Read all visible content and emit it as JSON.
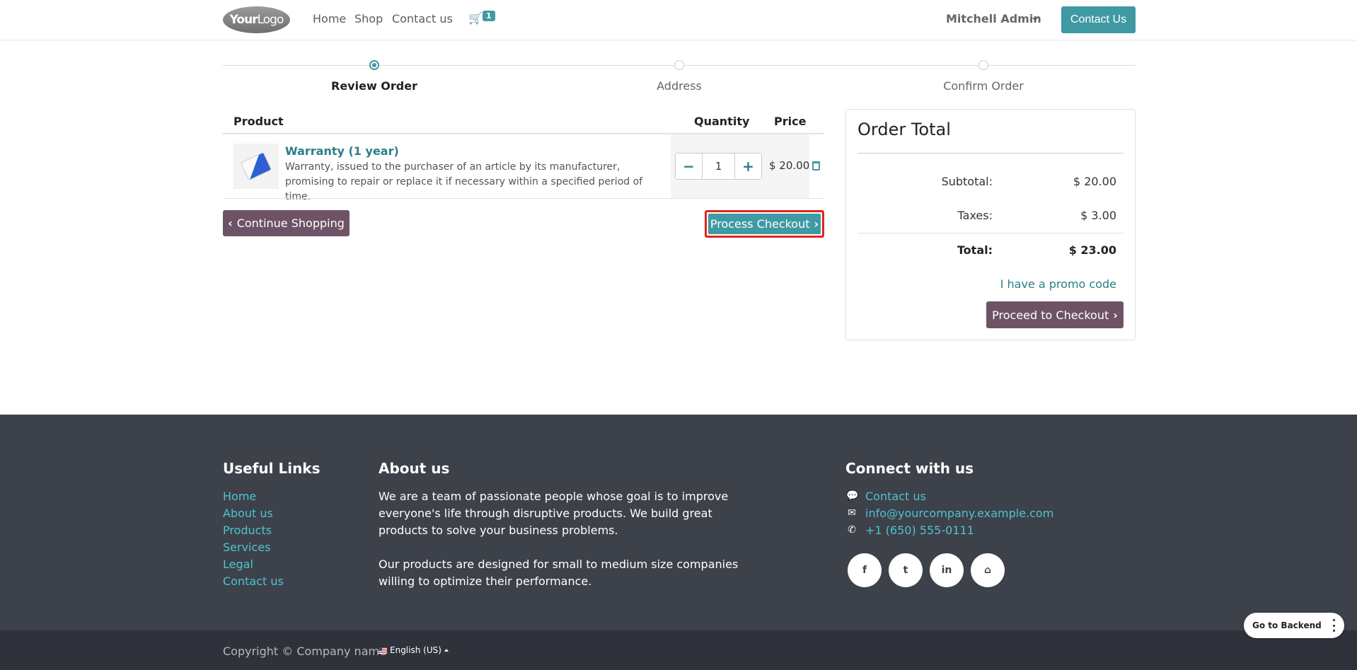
{
  "header": {
    "logo": {
      "prefix": "Your",
      "suffix": "Logo"
    },
    "nav": [
      "Home",
      "Shop",
      "Contact us"
    ],
    "cart_count": "1",
    "user_name": "Mitchell Admin",
    "contact_button": "Contact Us"
  },
  "steps": [
    {
      "label": "Review Order",
      "active": true
    },
    {
      "label": "Address",
      "active": false
    },
    {
      "label": "Confirm Order",
      "active": false
    }
  ],
  "cart": {
    "columns": {
      "product": "Product",
      "quantity": "Quantity",
      "price": "Price"
    },
    "items": [
      {
        "name": "Warranty (1 year)",
        "description": "Warranty, issued to the purchaser of an article by its manufacturer, promising to repair or replace it if necessary within a specified period of time.",
        "quantity": "1",
        "price": "$ 20.00"
      }
    ],
    "continue_label": "Continue Shopping",
    "process_checkout_label": "Process Checkout"
  },
  "order_total": {
    "title": "Order Total",
    "subtotal_label": "Subtotal:",
    "subtotal_value": "$ 20.00",
    "taxes_label": "Taxes:",
    "taxes_value": "$ 3.00",
    "total_label": "Total:",
    "total_value": "$ 23.00",
    "promo_link": "I have a promo code",
    "proceed_label": "Proceed to Checkout"
  },
  "footer": {
    "useful_links_title": "Useful Links",
    "useful_links": [
      "Home",
      "About us",
      "Products",
      "Services",
      "Legal",
      "Contact us"
    ],
    "about_title": "About us",
    "about_p1": "We are a team of passionate people whose goal is to improve everyone's life through disruptive products. We build great products to solve your business problems.",
    "about_p2": "Our products are designed for small to medium size companies willing to optimize their performance.",
    "connect_title": "Connect with us",
    "contact_link": "Contact us",
    "email": "info@yourcompany.example.com",
    "phone": "+1 (650) 555-0111",
    "social": [
      {
        "name": "facebook",
        "glyph": "f"
      },
      {
        "name": "twitter",
        "glyph": "t"
      },
      {
        "name": "linkedin",
        "glyph": "in"
      },
      {
        "name": "home",
        "glyph": "⌂"
      }
    ],
    "copyright": "Copyright © Company name",
    "language": "English (US)"
  },
  "backend_button": "Go to Backend",
  "colors": {
    "accent": "#3f9aa3",
    "secondary": "#6e5366",
    "footer_bg": "#3d4149",
    "highlight": "#e0241f"
  }
}
